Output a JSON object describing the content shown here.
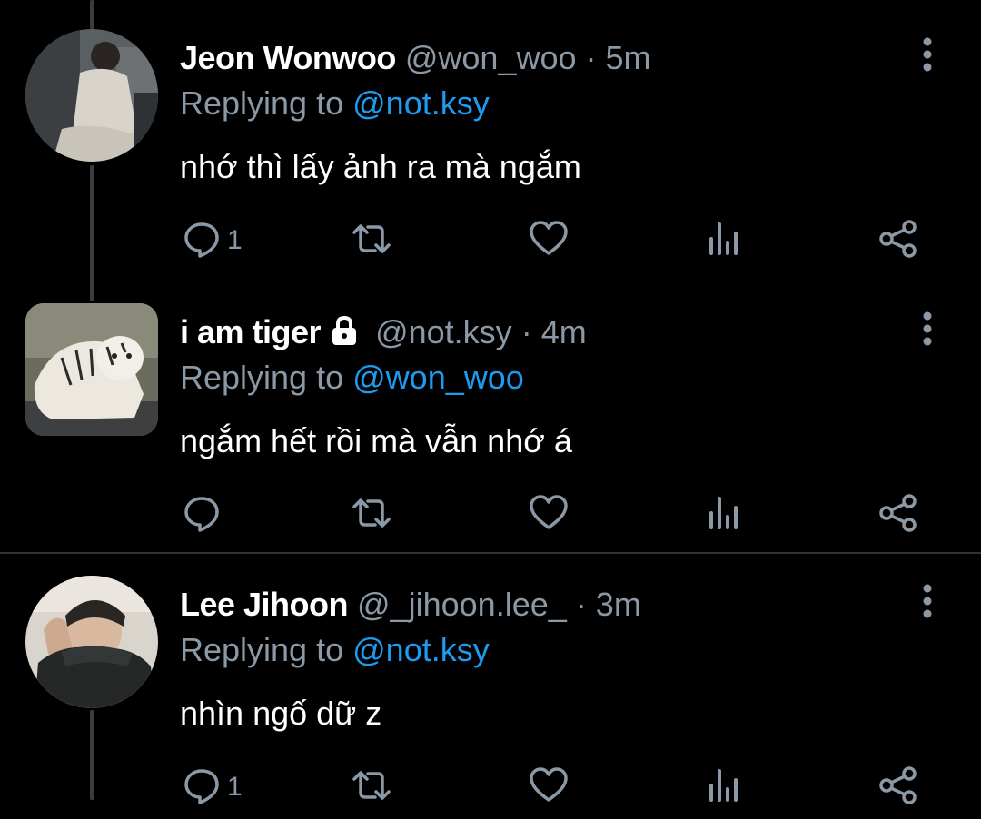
{
  "tweets": [
    {
      "name": "Jeon Wonwoo",
      "handle": "@won_woo",
      "separator": "·",
      "time": "5m",
      "replying_label": "Replying to",
      "replying_to": "@not.ksy",
      "text": "nhớ thì lấy ảnh ra mà ngắm",
      "reply_count": "1",
      "locked": false
    },
    {
      "name": "i am tiger",
      "handle": "@not.ksy",
      "separator": "·",
      "time": "4m",
      "replying_label": "Replying to",
      "replying_to": "@won_woo",
      "text": "ngắm hết rồi mà vẫn nhớ á",
      "reply_count": "",
      "locked": true
    },
    {
      "name": "Lee Jihoon",
      "handle": "@_jihoon.lee_",
      "separator": "·",
      "time": "3m",
      "replying_label": "Replying to",
      "replying_to": "@not.ksy",
      "text": "nhìn ngố dữ z",
      "reply_count": "1",
      "locked": false
    }
  ],
  "icons": [
    "reply-icon",
    "retweet-icon",
    "like-icon",
    "analytics-icon",
    "share-icon",
    "more-icon",
    "lock-icon"
  ],
  "colors": {
    "background": "#000000",
    "link": "#1d9bf0",
    "muted": "#8b98a5",
    "text": "#ffffff"
  }
}
